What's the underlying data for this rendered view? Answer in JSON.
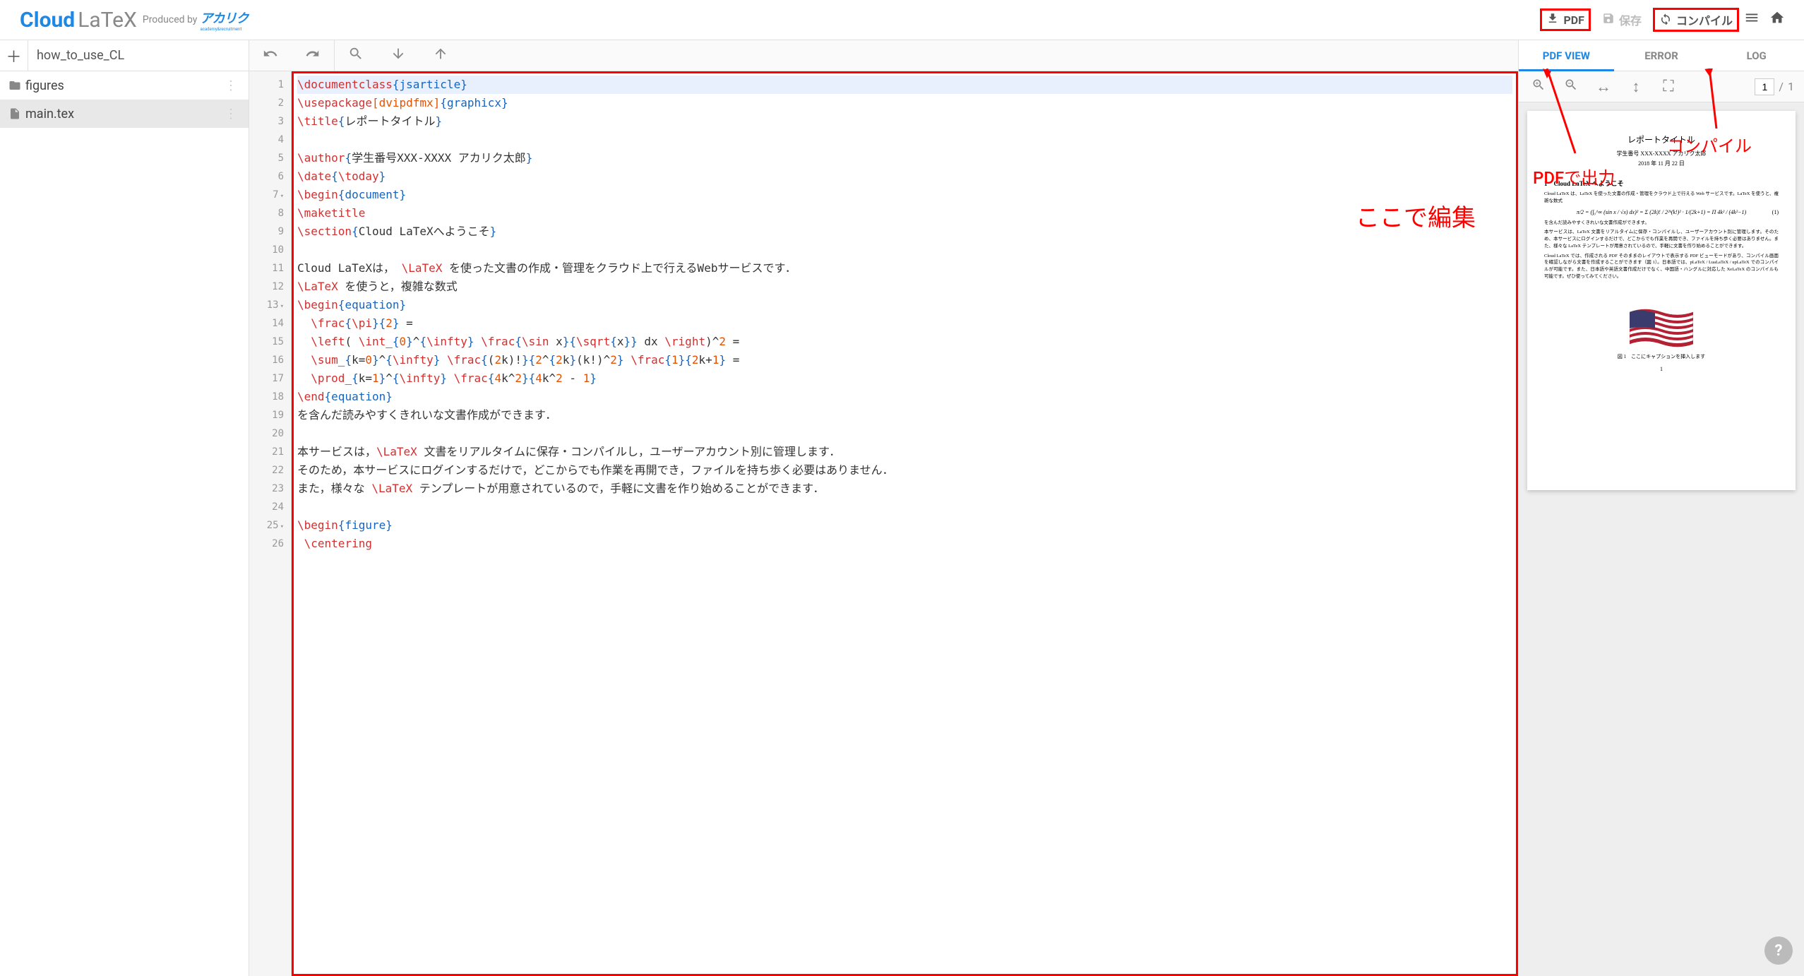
{
  "header": {
    "logo_cloud": "Cloud",
    "logo_latex": "LaTeX",
    "produced_by": "Produced by",
    "brand": "アカリク",
    "brand_sub": "academy&recruitment",
    "pdf_label": "PDF",
    "save_label": "保存",
    "compile_label": "コンパイル"
  },
  "project": {
    "name": "how_to_use_CL"
  },
  "files": [
    {
      "name": "figures",
      "type": "folder"
    },
    {
      "name": "main.tex",
      "type": "file",
      "active": true
    }
  ],
  "preview_tabs": {
    "pdf_view": "PDF VIEW",
    "error": "ERROR",
    "log": "LOG"
  },
  "page_indicator": {
    "current": "1",
    "total": "1",
    "sep": "/"
  },
  "annotations": {
    "edit_here": "ここで編集",
    "pdf_output": "PDFで出力",
    "compile": "コンパイル"
  },
  "help": "?",
  "pdf": {
    "title": "レポートタイトル",
    "author": "学生番号 XXX-XXXX アカリク太郎",
    "date": "2018 年 11 月 22 日",
    "section": "1　Cloud LaTeX へようこそ",
    "p1": "Cloud LaTeX は、LaTeX を使った文書の作成・管理をクラウド上で行える Web サービスです。LaTeX を使うと、複雑な数式",
    "eq": "π/2 = (∫₀^∞ (sin x / √x) dx)² = Σ (2k)! / 2²ᵏ(k!)² · 1/(2k+1) = Π 4k² / (4k²−1)",
    "eqno": "(1)",
    "p2": "を含んだ読みやすくきれいな文書作成ができます。",
    "p3": "本サービスは、LaTeX 文書をリアルタイムに保存・コンパイルし、ユーザーアカウント別に管理します。そのため、本サービスにログインするだけで、どこからでも作業を再開でき、ファイルを持ち歩く必要はありません。また、様々な LaTeX テンプレートが用意されているので、手軽に文書を作り始めることができます。",
    "p4": "Cloud LaTeX では、作成される PDF そのままのレイアウトで表示する PDF ビューモードがあり、コンパイル画面を確認しながら文書を作成することができます（図 1）。日本語では、pLaTeX / LuaLaTeX / upLaTeX でのコンパイルが可能です。また、日本語や英語文書作成だけでなく、中国語・ハングルに対応した XeLaTeX のコンパイルも可能です。ぜひ使ってみてください。",
    "caption": "図 1　ここにキャプションを挿入します",
    "pageno": "1"
  },
  "code_lines": [
    {
      "n": 1,
      "hl": true,
      "tokens": [
        [
          "cmd",
          "\\documentclass"
        ],
        [
          "grp",
          "{"
        ],
        [
          "grp",
          "jsarticle"
        ],
        [
          "grp",
          "}"
        ]
      ]
    },
    {
      "n": 2,
      "tokens": [
        [
          "cmd",
          "\\usepackage"
        ],
        [
          "opt",
          "["
        ],
        [
          "opt",
          "dvipdfmx"
        ],
        [
          "opt",
          "]"
        ],
        [
          "grp",
          "{"
        ],
        [
          "grp",
          "graphicx"
        ],
        [
          "grp",
          "}"
        ]
      ]
    },
    {
      "n": 3,
      "tokens": [
        [
          "cmd",
          "\\title"
        ],
        [
          "grp",
          "{"
        ],
        [
          "txt",
          "レポートタイトル"
        ],
        [
          "grp",
          "}"
        ]
      ]
    },
    {
      "n": 4,
      "tokens": []
    },
    {
      "n": 5,
      "tokens": [
        [
          "cmd",
          "\\author"
        ],
        [
          "grp",
          "{"
        ],
        [
          "txt",
          "学生番号XXX-XXXX アカリク太郎"
        ],
        [
          "grp",
          "}"
        ]
      ]
    },
    {
      "n": 6,
      "tokens": [
        [
          "cmd",
          "\\date"
        ],
        [
          "grp",
          "{"
        ],
        [
          "cmd",
          "\\today"
        ],
        [
          "grp",
          "}"
        ]
      ]
    },
    {
      "n": 7,
      "fold": true,
      "tokens": [
        [
          "cmd",
          "\\begin"
        ],
        [
          "grp",
          "{"
        ],
        [
          "grp",
          "document"
        ],
        [
          "grp",
          "}"
        ]
      ]
    },
    {
      "n": 8,
      "tokens": [
        [
          "cmd",
          "\\maketitle"
        ]
      ]
    },
    {
      "n": 9,
      "tokens": [
        [
          "cmd",
          "\\section"
        ],
        [
          "grp",
          "{"
        ],
        [
          "txt",
          "Cloud LaTeXへようこそ"
        ],
        [
          "grp",
          "}"
        ]
      ]
    },
    {
      "n": 10,
      "tokens": []
    },
    {
      "n": 11,
      "tokens": [
        [
          "txt",
          "Cloud LaTeXは， "
        ],
        [
          "cmd",
          "\\LaTeX"
        ],
        [
          "txt",
          " を使った文書の作成・管理をクラウド上で行えるWebサービスです．"
        ]
      ]
    },
    {
      "n": 12,
      "tokens": [
        [
          "cmd",
          "\\LaTeX"
        ],
        [
          "txt",
          " を使うと，複雑な数式"
        ]
      ]
    },
    {
      "n": 13,
      "fold": true,
      "tokens": [
        [
          "cmd",
          "\\begin"
        ],
        [
          "grp",
          "{"
        ],
        [
          "grp",
          "equation"
        ],
        [
          "grp",
          "}"
        ]
      ]
    },
    {
      "n": 14,
      "tokens": [
        [
          "txt",
          "  "
        ],
        [
          "cmd",
          "\\frac"
        ],
        [
          "grp",
          "{"
        ],
        [
          "cmd",
          "\\pi"
        ],
        [
          "grp",
          "}{"
        ],
        [
          "opt",
          "2"
        ],
        [
          "grp",
          "}"
        ],
        [
          "txt",
          " ="
        ]
      ]
    },
    {
      "n": 15,
      "tokens": [
        [
          "txt",
          "  "
        ],
        [
          "cmd",
          "\\left"
        ],
        [
          "txt",
          "( "
        ],
        [
          "cmd",
          "\\int"
        ],
        [
          "txt",
          "_"
        ],
        [
          "grp",
          "{"
        ],
        [
          "opt",
          "0"
        ],
        [
          "grp",
          "}"
        ],
        [
          "txt",
          "^"
        ],
        [
          "grp",
          "{"
        ],
        [
          "cmd",
          "\\infty"
        ],
        [
          "grp",
          "}"
        ],
        [
          "txt",
          " "
        ],
        [
          "cmd",
          "\\frac"
        ],
        [
          "grp",
          "{"
        ],
        [
          "cmd",
          "\\sin"
        ],
        [
          "txt",
          " x"
        ],
        [
          "grp",
          "}{"
        ],
        [
          "cmd",
          "\\sqrt"
        ],
        [
          "grp",
          "{"
        ],
        [
          "txt",
          "x"
        ],
        [
          "grp",
          "}}"
        ],
        [
          "txt",
          " dx "
        ],
        [
          "cmd",
          "\\right"
        ],
        [
          "txt",
          ")^"
        ],
        [
          "opt",
          "2"
        ],
        [
          "txt",
          " ="
        ]
      ]
    },
    {
      "n": 16,
      "tokens": [
        [
          "txt",
          "  "
        ],
        [
          "cmd",
          "\\sum"
        ],
        [
          "txt",
          "_"
        ],
        [
          "grp",
          "{"
        ],
        [
          "txt",
          "k="
        ],
        [
          "opt",
          "0"
        ],
        [
          "grp",
          "}"
        ],
        [
          "txt",
          "^"
        ],
        [
          "grp",
          "{"
        ],
        [
          "cmd",
          "\\infty"
        ],
        [
          "grp",
          "}"
        ],
        [
          "txt",
          " "
        ],
        [
          "cmd",
          "\\frac"
        ],
        [
          "grp",
          "{"
        ],
        [
          "txt",
          "("
        ],
        [
          "opt",
          "2"
        ],
        [
          "txt",
          "k)!"
        ],
        [
          "grp",
          "}{"
        ],
        [
          "opt",
          "2"
        ],
        [
          "txt",
          "^"
        ],
        [
          "grp",
          "{"
        ],
        [
          "opt",
          "2"
        ],
        [
          "txt",
          "k"
        ],
        [
          "grp",
          "}"
        ],
        [
          "txt",
          "(k!)^"
        ],
        [
          "opt",
          "2"
        ],
        [
          "grp",
          "}"
        ],
        [
          "txt",
          " "
        ],
        [
          "cmd",
          "\\frac"
        ],
        [
          "grp",
          "{"
        ],
        [
          "opt",
          "1"
        ],
        [
          "grp",
          "}{"
        ],
        [
          "opt",
          "2"
        ],
        [
          "txt",
          "k+"
        ],
        [
          "opt",
          "1"
        ],
        [
          "grp",
          "}"
        ],
        [
          "txt",
          " ="
        ]
      ]
    },
    {
      "n": 17,
      "tokens": [
        [
          "txt",
          "  "
        ],
        [
          "cmd",
          "\\prod"
        ],
        [
          "txt",
          "_"
        ],
        [
          "grp",
          "{"
        ],
        [
          "txt",
          "k="
        ],
        [
          "opt",
          "1"
        ],
        [
          "grp",
          "}"
        ],
        [
          "txt",
          "^"
        ],
        [
          "grp",
          "{"
        ],
        [
          "cmd",
          "\\infty"
        ],
        [
          "grp",
          "}"
        ],
        [
          "txt",
          " "
        ],
        [
          "cmd",
          "\\frac"
        ],
        [
          "grp",
          "{"
        ],
        [
          "opt",
          "4"
        ],
        [
          "txt",
          "k^"
        ],
        [
          "opt",
          "2"
        ],
        [
          "grp",
          "}{"
        ],
        [
          "opt",
          "4"
        ],
        [
          "txt",
          "k^"
        ],
        [
          "opt",
          "2"
        ],
        [
          "txt",
          " - "
        ],
        [
          "opt",
          "1"
        ],
        [
          "grp",
          "}"
        ]
      ]
    },
    {
      "n": 18,
      "tokens": [
        [
          "cmd",
          "\\end"
        ],
        [
          "grp",
          "{"
        ],
        [
          "grp",
          "equation"
        ],
        [
          "grp",
          "}"
        ]
      ]
    },
    {
      "n": 19,
      "tokens": [
        [
          "txt",
          "を含んだ読みやすくきれいな文書作成ができます．"
        ]
      ]
    },
    {
      "n": 20,
      "tokens": []
    },
    {
      "n": 21,
      "tokens": [
        [
          "txt",
          "本サービスは，"
        ],
        [
          "cmd",
          "\\LaTeX"
        ],
        [
          "txt",
          " 文書をリアルタイムに保存・コンパイルし，ユーザーアカウント別に管理します．"
        ]
      ]
    },
    {
      "n": 22,
      "tokens": [
        [
          "txt",
          "そのため，本サービスにログインするだけで，どこからでも作業を再開でき，ファイルを持ち歩く必要はありません．"
        ]
      ]
    },
    {
      "n": 23,
      "tokens": [
        [
          "txt",
          "また，様々な "
        ],
        [
          "cmd",
          "\\LaTeX"
        ],
        [
          "txt",
          " テンプレートが用意されているので，手軽に文書を作り始めることができます．"
        ]
      ]
    },
    {
      "n": 24,
      "tokens": []
    },
    {
      "n": 25,
      "fold": true,
      "tokens": [
        [
          "cmd",
          "\\begin"
        ],
        [
          "grp",
          "{"
        ],
        [
          "grp",
          "figure"
        ],
        [
          "grp",
          "}"
        ]
      ]
    },
    {
      "n": 26,
      "tokens": [
        [
          "txt",
          " "
        ],
        [
          "cmd",
          "\\centering"
        ]
      ]
    }
  ]
}
